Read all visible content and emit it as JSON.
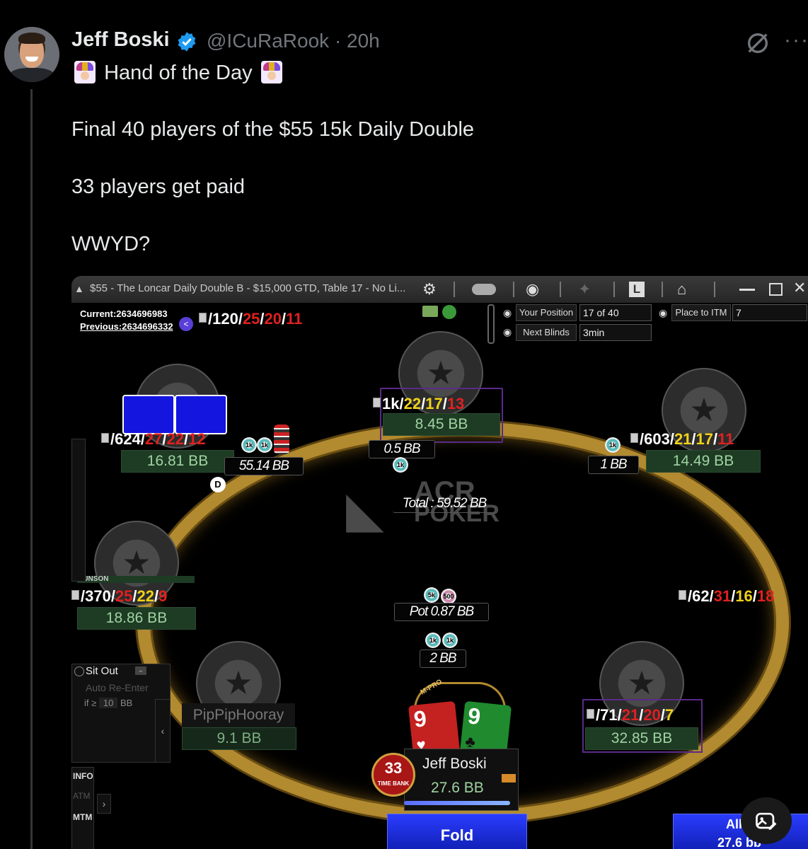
{
  "tweet": {
    "author_name": "Jeff Boski",
    "handle": "@ICuRaRook",
    "time": "· 20h",
    "line1": "Hand of the Day",
    "line2": "Final 40 players of the $55 15k Daily Double",
    "line3": "33 players get paid",
    "line4": "WWYD?",
    "more_icon": "ellipsis-icon"
  },
  "window": {
    "title": "$55 - The Loncar Daily Double B - $15,000 GTD, Table 17 - No Li..."
  },
  "hand": {
    "current": "Current:2634696983",
    "previous": "Previous:2634696332",
    "your_position_label": "Your Position",
    "your_position_value": "17 of 40",
    "place_itm_label": "Place to ITM",
    "place_itm_value": "7",
    "next_blinds_label": "Next Blinds",
    "next_blinds_value": "3min",
    "total": "Total : 59.52 BB",
    "pot": "Pot 0.87 BB",
    "logo_line1": "ACR",
    "logo_line2": "POKER"
  },
  "seats": {
    "topleft_stats": [
      "/120/",
      "25",
      "/",
      "20",
      "/",
      "11"
    ],
    "left": {
      "stats": [
        "/624/",
        "27",
        "/",
        "22",
        "/",
        "12"
      ],
      "stack": "16.81 BB",
      "bet": "55.14 BB"
    },
    "top": {
      "stats": [
        "1k/",
        "22",
        "/",
        "17",
        "/",
        "13"
      ],
      "stack": "8.45 BB",
      "bet": "0.5 BB"
    },
    "right": {
      "stats": [
        "/603/",
        "21",
        "/",
        "17",
        "/",
        "11"
      ],
      "stack": "14.49 BB",
      "bet": "1 BB"
    },
    "midleft": {
      "name": "MUNSON",
      "stats": [
        "/370/",
        "25",
        "/",
        "22",
        "/",
        "9"
      ],
      "stack": "18.86 BB"
    },
    "midright": {
      "stats": [
        "/62/",
        "31",
        "/",
        "16",
        "/",
        "18"
      ]
    },
    "bottomleft": {
      "name": "PipPipHooray",
      "stack": "9.1 BB"
    },
    "bottomright": {
      "stats": [
        "/71/",
        "21",
        "/",
        "20",
        "/",
        "7"
      ],
      "stack": "32.85 BB"
    },
    "hero": {
      "name": "Jeff Boski",
      "stack": "27.6 BB",
      "bet": "2 BB",
      "timebank": "33",
      "timebank_label": "TIME BANK",
      "card1": "9",
      "card2": "9",
      "badge": "M-PRO"
    }
  },
  "controls": {
    "sit_out": "Sit Out",
    "auto_reenter": "Auto Re-Enter",
    "if_label": "if ≥",
    "if_value": "10",
    "if_unit": "BB",
    "info": "INFO",
    "atm": "ATM",
    "mtm": "MTM",
    "fold": "Fold",
    "allin_label": "All",
    "allin_amount": "27.6 bb"
  },
  "colors": {
    "stat_red": "#e02020",
    "stat_yellow": "#f0d21a",
    "rail_gold": "#b28a2f",
    "fold_blue": "#1a2ee0",
    "verified_blue": "#1d9bf0"
  }
}
